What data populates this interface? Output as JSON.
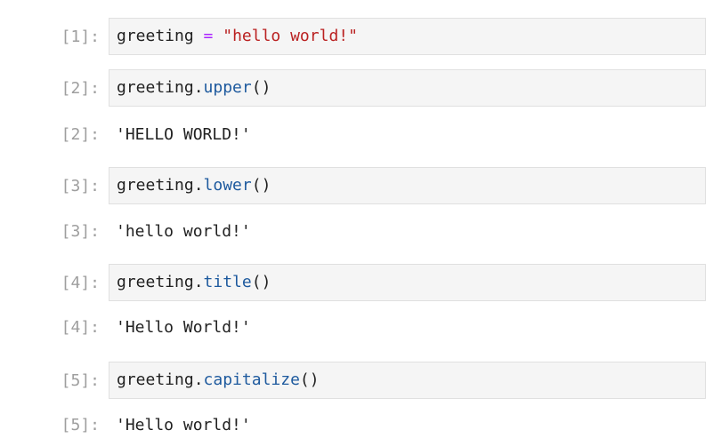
{
  "cells": [
    {
      "prompt": "[1]:",
      "code": {
        "var": "greeting",
        "op": "=",
        "string": "\"hello world!\""
      }
    },
    {
      "prompt": "[2]:",
      "code": {
        "var": "greeting",
        "dot": ".",
        "method": "upper",
        "parens": "()"
      },
      "output_prompt": "[2]:",
      "output": "'HELLO WORLD!'"
    },
    {
      "prompt": "[3]:",
      "code": {
        "var": "greeting",
        "dot": ".",
        "method": "lower",
        "parens": "()"
      },
      "output_prompt": "[3]:",
      "output": "'hello world!'"
    },
    {
      "prompt": "[4]:",
      "code": {
        "var": "greeting",
        "dot": ".",
        "method": "title",
        "parens": "()"
      },
      "output_prompt": "[4]:",
      "output": "'Hello World!'"
    },
    {
      "prompt": "[5]:",
      "code": {
        "var": "greeting",
        "dot": ".",
        "method": "capitalize",
        "parens": "()"
      },
      "output_prompt": "[5]:",
      "output": "'Hello world!'"
    }
  ],
  "colors": {
    "prompt": "#9e9e9e",
    "input_bg": "#f5f5f5",
    "input_border": "#e0e0e0",
    "operator": "#aa22ff",
    "string": "#ba2121",
    "method": "#1e5a9e"
  }
}
